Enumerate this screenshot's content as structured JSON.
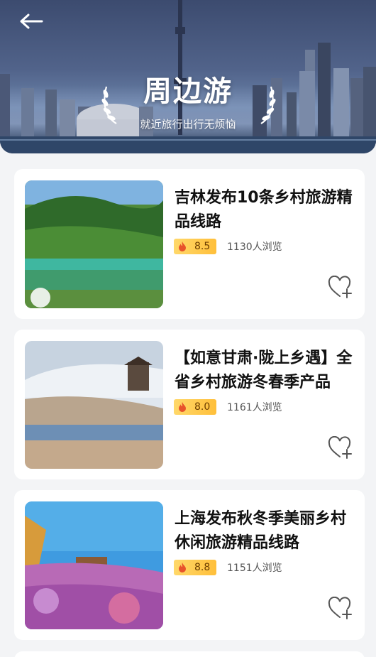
{
  "header": {
    "title": "周边游",
    "subtitle": "就近旅行出行无烦恼"
  },
  "items": [
    {
      "title": "吉林发布10条乡村旅游精品线路",
      "rating": "8.5",
      "views": "1130人浏览",
      "image": "green-lake-forest"
    },
    {
      "title": "【如意甘肃·陇上乡遇】全省乡村旅游冬春季产品",
      "rating": "8.0",
      "views": "1161人浏览",
      "image": "snowy-pagoda-lake"
    },
    {
      "title": "上海发布秋冬季美丽乡村休闲旅游精品线路",
      "rating": "8.8",
      "views": "1151人浏览",
      "image": "purple-flower-field"
    }
  ],
  "colors": {
    "rating_bg": "#ffc84a",
    "fire": "#e8532b",
    "page_bg": "#f3f4f6"
  },
  "icons": {
    "back": "arrow-left-icon",
    "favorite": "heart-plus-icon",
    "rating": "fire-icon",
    "decor": "laurel-icon"
  }
}
